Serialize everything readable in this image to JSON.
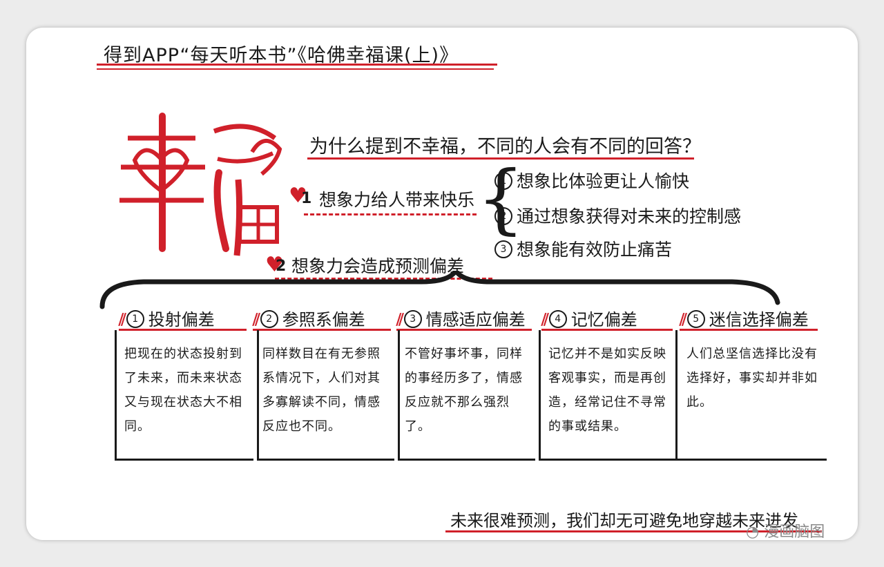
{
  "title": "得到APP“每天听本书”《哈佛幸福课(上)》",
  "big_character": "幸福",
  "question": "为什么提到不幸福，不同的人会有不同的回答？",
  "points": [
    {
      "number": "1",
      "text": "想象力给人带来快乐"
    },
    {
      "number": "2",
      "text": "想象力会造成预测偏差"
    }
  ],
  "sub_points": [
    {
      "number": "1",
      "text": "想象比体验更让人愉快"
    },
    {
      "number": "2",
      "text": "通过想象获得对未来的控制感"
    },
    {
      "number": "3",
      "text": "想象能有效防止痛苦"
    }
  ],
  "biases": [
    {
      "number": "1",
      "title": "投射偏差",
      "text": "把现在的状态投射到了未来，而未来状态又与现在状态大不相同。"
    },
    {
      "number": "2",
      "title": "参照系偏差",
      "text": "同样数目在有无参照系情况下，人们对其多寡解读不同，情感反应也不同。"
    },
    {
      "number": "3",
      "title": "情感适应偏差",
      "text": "不管好事坏事，同样的事经历多了，情感反应就不那么强烈了。"
    },
    {
      "number": "4",
      "title": "记忆偏差",
      "text": "记忆并不是如实反映客观事实，而是再创造，经常记住不寻常的事或结果。"
    },
    {
      "number": "5",
      "title": "迷信选择偏差",
      "text": "人们总坚信选择比没有选择好，事实却并非如此。"
    }
  ],
  "conclusion": "未来很难预测，我们却无可避免地穿越未来进发",
  "watermark": "漫画脑图",
  "colors": {
    "accent": "#d0202a",
    "ink": "#1a1a1a",
    "background": "#ffffff"
  }
}
